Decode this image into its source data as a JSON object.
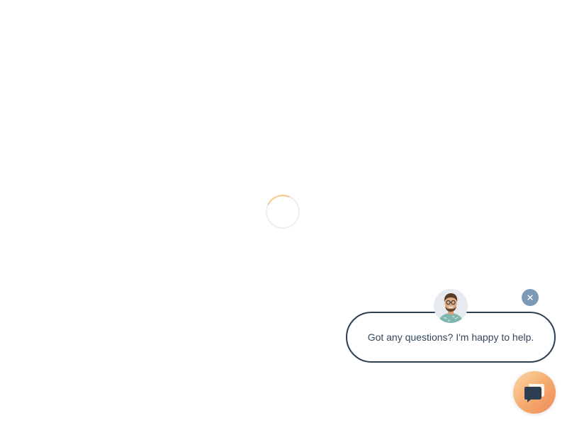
{
  "chat_widget": {
    "greeting": "Got any questions? I'm happy to help.",
    "avatar_icon": "agent-avatar",
    "close_icon": "close-icon",
    "launcher_icon": "chat-bubbles-icon",
    "colors": {
      "bubble_border": "#2d3e50",
      "text": "#33475b",
      "close_bg": "#7c98b6",
      "launcher_gradient_start": "#fbd9a8",
      "launcher_gradient_end": "#f08a5a",
      "launcher_icon": "#2d3e50"
    }
  },
  "loading": {
    "spinner_icon": "loading-spinner-icon",
    "spinner_color": "#f6c98a"
  }
}
